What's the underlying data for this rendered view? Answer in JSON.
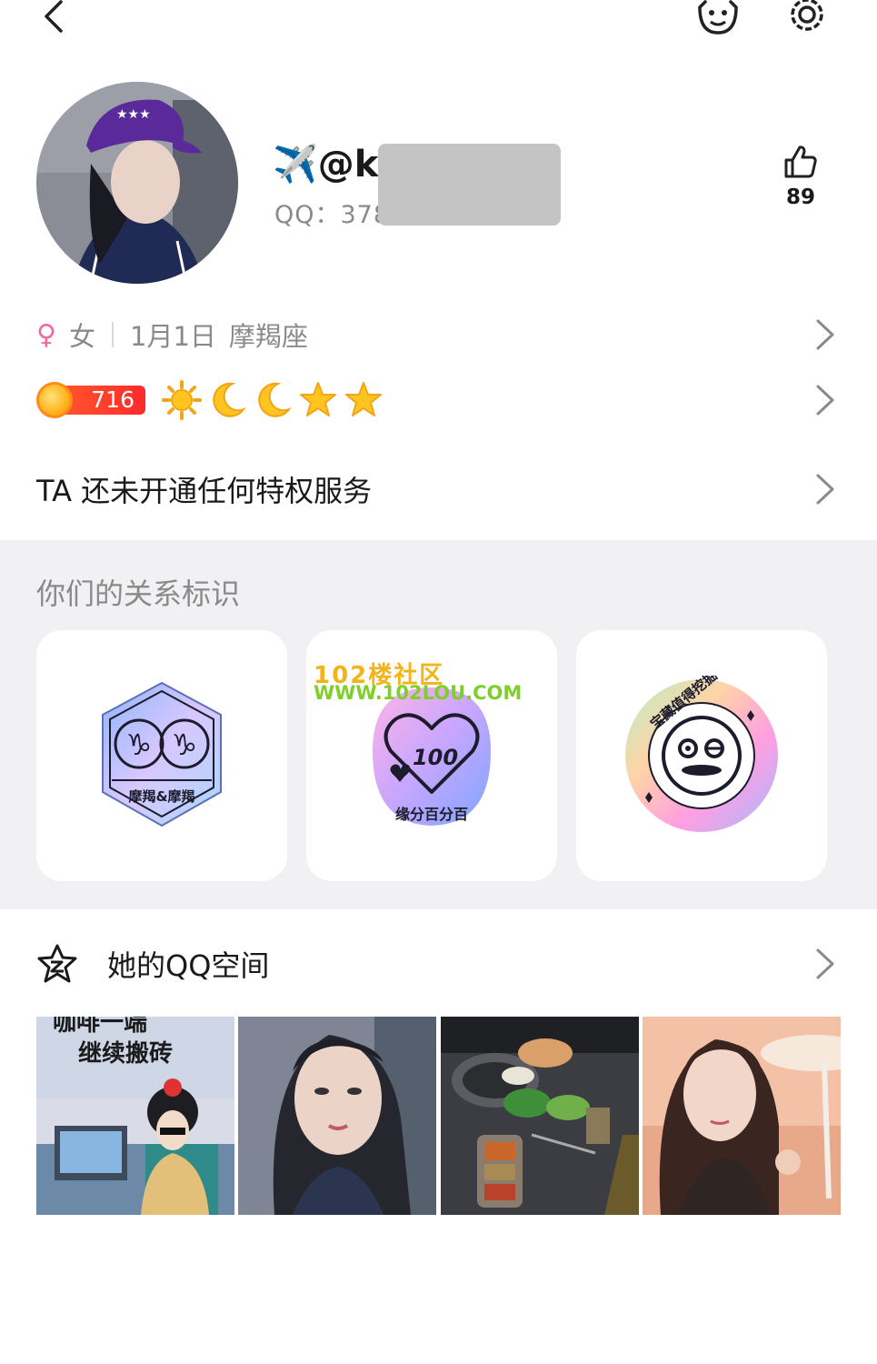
{
  "header": {
    "nickname_prefix": "✈️@k",
    "qq_label": "QQ：378",
    "like_count": "89"
  },
  "info": {
    "gender_symbol": "♀",
    "gender": "女",
    "birthday": "1月1日",
    "zodiac": "摩羯座"
  },
  "level": {
    "value": "716",
    "icons": [
      "sun-icon",
      "moon-icon",
      "moon-icon",
      "star-icon",
      "star-icon"
    ]
  },
  "privilege": {
    "text": "TA 还未开通任何特权服务"
  },
  "relations": {
    "title": "你们的关系标识",
    "badges": [
      {
        "label": "摩羯&摩羯"
      },
      {
        "label": "缘分百分百",
        "number": "100"
      },
      {
        "label": "宝藏值得挖掘"
      }
    ],
    "watermark_line1": "102楼社区",
    "watermark_line2": "WWW.102LOU.COM"
  },
  "qzone": {
    "title": "她的QQ空间",
    "photo1_caption_line1": "咖啡一端",
    "photo1_caption_line2": "继续搬砖"
  },
  "colors": {
    "section_bg": "#f1f1f3",
    "text_secondary": "#8a8a8a",
    "level_red": "#ff2b2b",
    "redaction": "#c4c4c4"
  }
}
